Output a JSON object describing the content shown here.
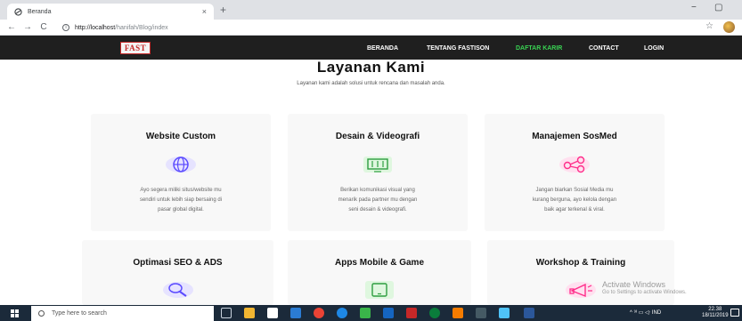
{
  "browser": {
    "tab_title": "Beranda",
    "tab_close": "×",
    "new_tab": "+",
    "url_host": "http://localhost",
    "url_path": "/hanifah/Blog/index",
    "back": "←",
    "forward": "→",
    "reload": "C",
    "bookmark_star": "☆",
    "minimize": "−",
    "maximize": "▢"
  },
  "site": {
    "logo_text": "FAST",
    "nav": [
      {
        "label": "BERANDA"
      },
      {
        "label": "TENTANG FASTISON"
      },
      {
        "label": "DAFTAR KARIR"
      },
      {
        "label": "CONTACT"
      },
      {
        "label": "LOGIN"
      }
    ],
    "accent_color": "#39d353",
    "heading": "Layanan Kami",
    "subheading": "Layanan kami adalah solusi untuk rencana dan masalah anda.",
    "cards": [
      {
        "title": "Website Custom",
        "icon": "globe-icon",
        "desc_lines": [
          "Ayo segera miliki situs/website mu",
          "sendiri untuk lebih siap bersaing di",
          "pasar global digital."
        ]
      },
      {
        "title": "Desain & Videografi",
        "icon": "design-icon",
        "desc_lines": [
          "Berikan komunikasi visual yang",
          "menarik pada partner mu dengan",
          "seni desain & videografi."
        ]
      },
      {
        "title": "Manajemen SosMed",
        "icon": "share-icon",
        "desc_lines": [
          "Jangan biarkan Sosial Media mu",
          "kurang berguna, ayo kelola dengan",
          "baik agar terkenal & viral."
        ]
      },
      {
        "title": "Optimasi SEO & ADS",
        "icon": "search-icon"
      },
      {
        "title": "Apps Mobile & Game",
        "icon": "tablet-icon"
      },
      {
        "title": "Workshop & Training",
        "icon": "megaphone-icon"
      }
    ]
  },
  "watermark": {
    "line1": "Activate Windows",
    "line2": "Go to Settings to activate Windows."
  },
  "taskbar": {
    "search_placeholder": "Type here to search",
    "tray_text": "^ ⁹ᴵ ▭ ◁ᐧ IND",
    "time": "22.38",
    "date": "18/11/2019"
  }
}
